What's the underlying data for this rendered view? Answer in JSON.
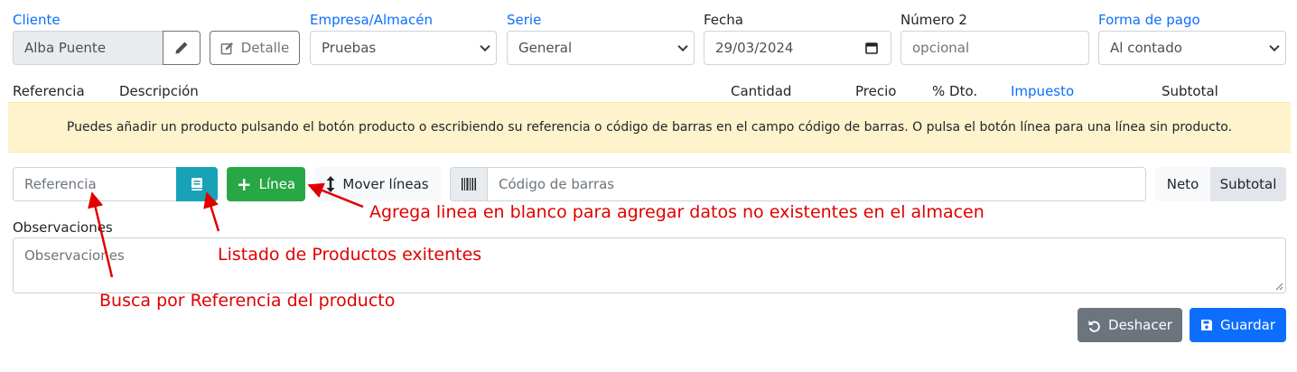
{
  "header": {
    "cliente": {
      "label": "Cliente",
      "value": "Alba Puente",
      "detalle_label": "Detalle"
    },
    "empresa": {
      "label": "Empresa/Almacén",
      "value": "Pruebas"
    },
    "serie": {
      "label": "Serie",
      "value": "General"
    },
    "fecha": {
      "label": "Fecha",
      "value": "29/03/2024"
    },
    "numero2": {
      "label": "Número 2",
      "placeholder": "opcional"
    },
    "forma_pago": {
      "label": "Forma de pago",
      "value": "Al contado"
    }
  },
  "columns": {
    "referencia": "Referencia",
    "descripcion": "Descripción",
    "cantidad": "Cantidad",
    "precio": "Precio",
    "dto": "% Dto.",
    "impuesto": "Impuesto",
    "subtotal": "Subtotal"
  },
  "alert": {
    "text": "Puedes añadir un producto pulsando el botón producto o escribiendo su referencia o código de barras en el campo código de barras. O pulsa el botón línea para una línea sin producto."
  },
  "toolbar": {
    "referencia_placeholder": "Referencia",
    "linea_label": "Línea",
    "mover_label": "Mover líneas",
    "barcode_placeholder": "Código de barras",
    "neto_label": "Neto",
    "subtotal_label": "Subtotal"
  },
  "observaciones": {
    "label": "Observaciones",
    "placeholder": "Observaciones"
  },
  "actions": {
    "deshacer_label": "Deshacer",
    "guardar_label": "Guardar"
  },
  "annotations": {
    "agrega": "Agrega linea en blanco para agregar datos no existentes en el almacen",
    "listado": "Listado de Productos exitentes",
    "busca": "Busca por Referencia del producto"
  },
  "colors": {
    "link": "#0d6efd",
    "success": "#28a745",
    "info": "#17a2b8",
    "primary": "#0d6efd",
    "secondary": "#6c757d",
    "alert_bg": "#fff3cd",
    "annotation": "#e00000"
  }
}
